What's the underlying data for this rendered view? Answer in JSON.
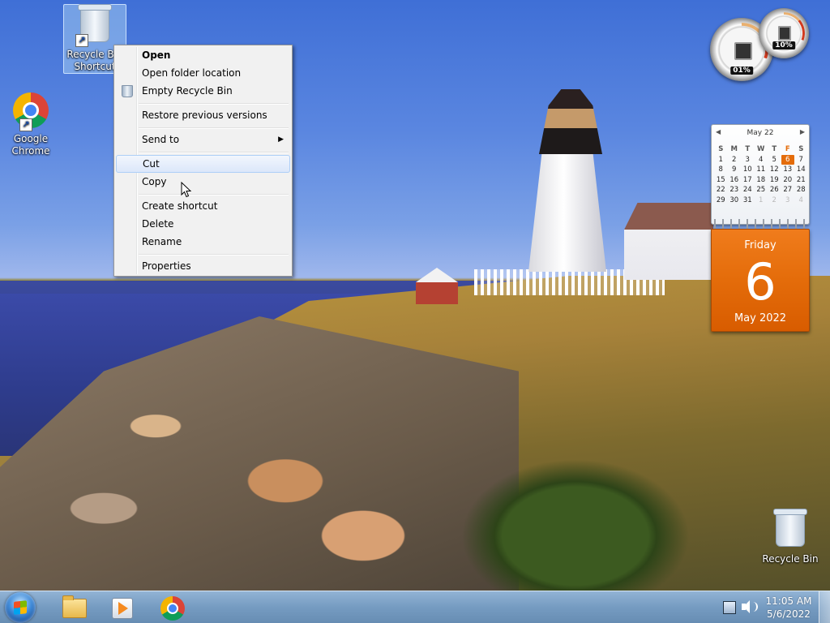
{
  "desktop": {
    "icons": [
      {
        "label_line1": "Recycle Bin",
        "label_line2": "Shortcut",
        "icon": "recycle-bin-icon",
        "selected": true
      },
      {
        "label_line1": "Google",
        "label_line2": "Chrome",
        "icon": "chrome-icon"
      },
      {
        "label": "Recycle Bin",
        "icon": "recycle-bin-icon"
      }
    ]
  },
  "context_menu": {
    "items": [
      {
        "label": "Open",
        "bold": true
      },
      {
        "label": "Open folder location"
      },
      {
        "label": "Empty Recycle Bin",
        "icon": "recycle-bin-icon"
      },
      {
        "label": "Restore previous versions"
      },
      {
        "label": "Send to",
        "submenu_arrow": "▶"
      },
      {
        "label": "Cut",
        "hover": true
      },
      {
        "label": "Copy"
      },
      {
        "label": "Create shortcut"
      },
      {
        "label": "Delete"
      },
      {
        "label": "Rename"
      },
      {
        "label": "Properties"
      }
    ]
  },
  "gadgets": {
    "cpu_meter": {
      "cpu_percent": "01%",
      "memory_percent": "10%"
    },
    "calendar": {
      "month_header": "May 22",
      "prev": "◀",
      "next": "▶",
      "weekday_headers": [
        "S",
        "M",
        "T",
        "W",
        "T",
        "F",
        "S"
      ],
      "weeks": [
        [
          "1",
          "2",
          "3",
          "4",
          "5",
          "6",
          "7"
        ],
        [
          "8",
          "9",
          "10",
          "11",
          "12",
          "13",
          "14"
        ],
        [
          "15",
          "16",
          "17",
          "18",
          "19",
          "20",
          "21"
        ],
        [
          "22",
          "23",
          "24",
          "25",
          "26",
          "27",
          "28"
        ],
        [
          "29",
          "30",
          "31",
          "1",
          "2",
          "3",
          "4"
        ]
      ],
      "today": "6",
      "day_name": "Friday",
      "day_number": "6",
      "month_year": "May 2022"
    }
  },
  "taskbar": {
    "pinned": [
      "start-orb",
      "windows-explorer-icon",
      "windows-media-player-icon",
      "chrome-icon"
    ],
    "clock": {
      "time": "11:05 AM",
      "date": "5/6/2022"
    }
  },
  "colors": {
    "accent_orange": "#e46c0a",
    "menu_hover": "#dbe7fa"
  }
}
